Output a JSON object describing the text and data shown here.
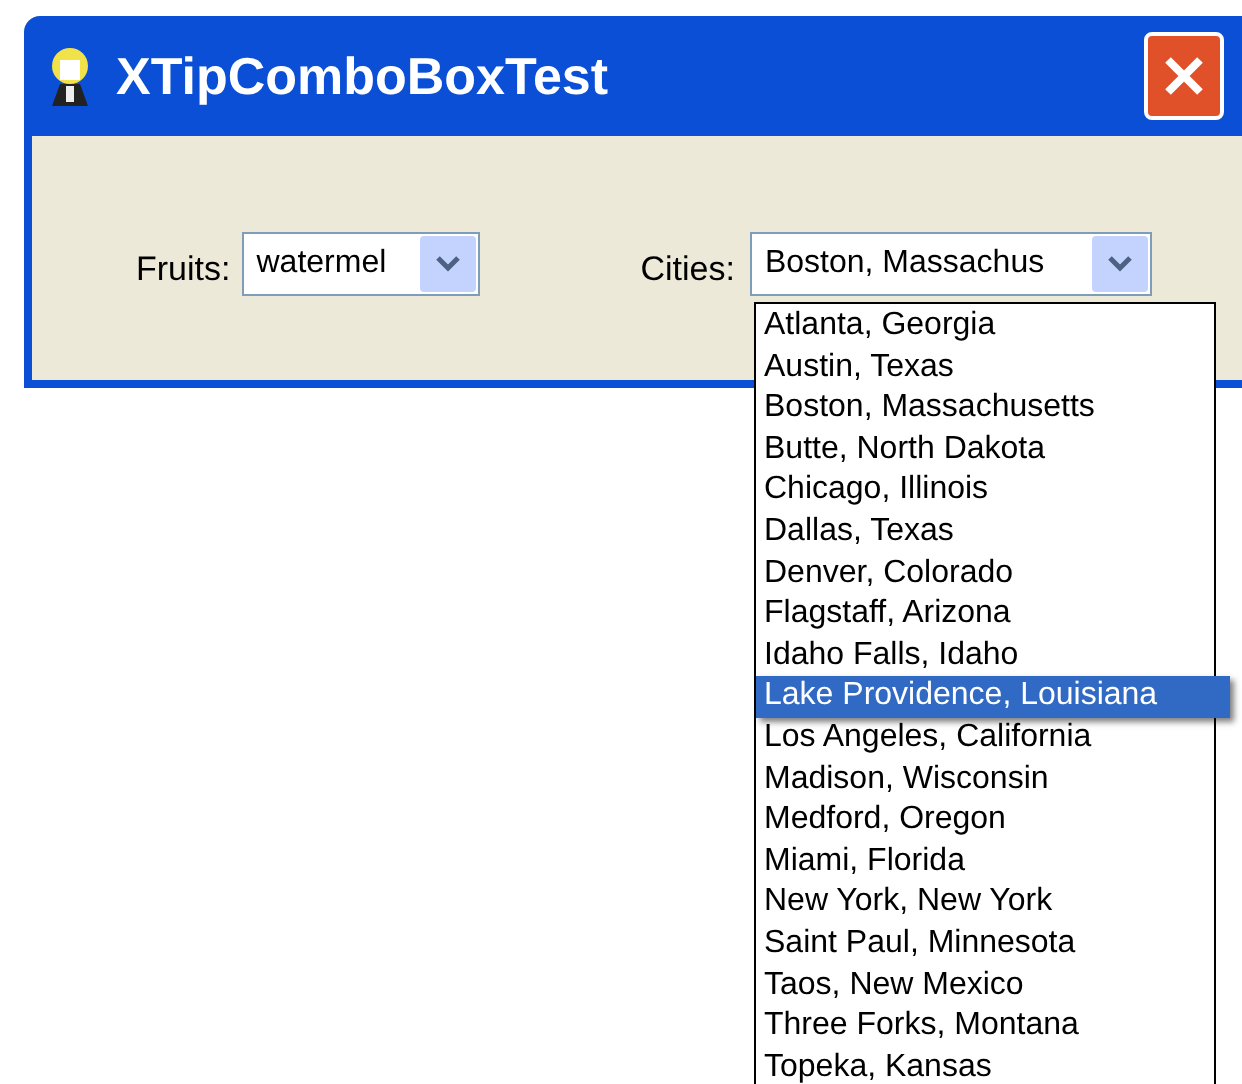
{
  "window": {
    "title": "XTipComboBoxTest"
  },
  "fruits": {
    "label": "Fruits:",
    "value": "watermel"
  },
  "cities": {
    "label": "Cities:",
    "value": "Boston, Massachus",
    "expanded": true,
    "options": [
      {
        "text": "Atlanta, Georgia",
        "selected": false
      },
      {
        "text": "Austin, Texas",
        "selected": false
      },
      {
        "text": "Boston, Massachusetts",
        "selected": false
      },
      {
        "text": "Butte, North Dakota",
        "selected": false
      },
      {
        "text": "Chicago, Illinois",
        "selected": false
      },
      {
        "text": "Dallas, Texas",
        "selected": false
      },
      {
        "text": "Denver, Colorado",
        "selected": false
      },
      {
        "text": "Flagstaff, Arizona",
        "selected": false
      },
      {
        "text": "Idaho Falls, Idaho",
        "selected": false
      },
      {
        "text": "Lake Providence, Louisiana",
        "selected": true
      },
      {
        "text": "Los Angeles, California",
        "selected": false
      },
      {
        "text": "Madison, Wisconsin",
        "selected": false
      },
      {
        "text": "Medford, Oregon",
        "selected": false
      },
      {
        "text": "Miami, Florida",
        "selected": false
      },
      {
        "text": "New York, New York",
        "selected": false
      },
      {
        "text": "Saint Paul, Minnesota",
        "selected": false
      },
      {
        "text": "Taos, New Mexico",
        "selected": false
      },
      {
        "text": "Three Forks, Montana",
        "selected": false
      },
      {
        "text": "Topeka, Kansas",
        "selected": false
      }
    ]
  }
}
